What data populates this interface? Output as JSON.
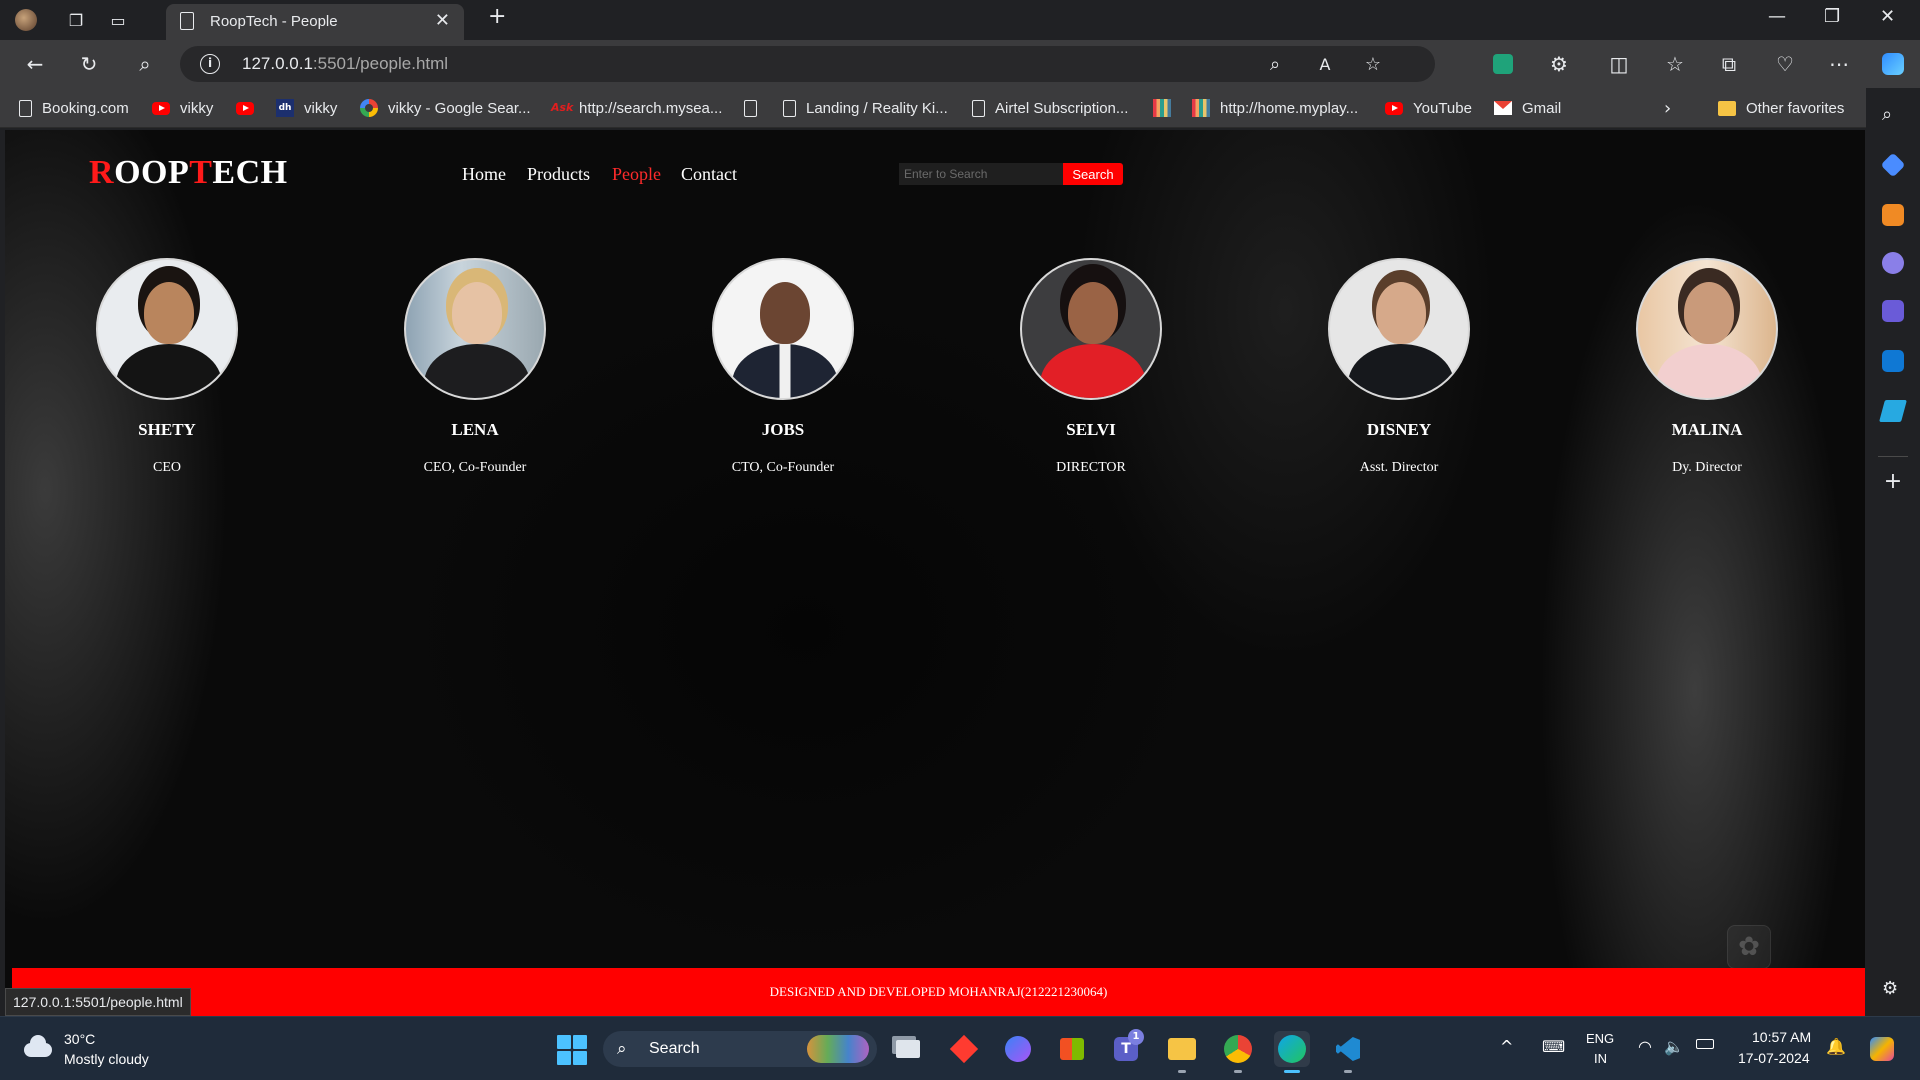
{
  "browser": {
    "tab_title": "RoopTech - People",
    "url_host": "127.0.0.1",
    "url_rest": ":5501/people.html",
    "bookmarks": [
      {
        "label": "Booking.com",
        "icon": "doc-icon"
      },
      {
        "label": "vikky",
        "icon": "youtube-icon"
      },
      {
        "label": "",
        "icon": "youtube-icon"
      },
      {
        "label": "vikky",
        "icon": "dailyhunt-icon"
      },
      {
        "label": "vikky - Google Sear...",
        "icon": "google-icon"
      },
      {
        "label": "http://search.mysea...",
        "icon": "ask-icon"
      },
      {
        "label": "",
        "icon": "doc-icon"
      },
      {
        "label": "Landing / Reality Ki...",
        "icon": "doc-icon"
      },
      {
        "label": "Airtel Subscription...",
        "icon": "doc-icon"
      },
      {
        "label": "",
        "icon": "colorful-bars-icon"
      },
      {
        "label": "http://home.myplay...",
        "icon": "colorful-bars-icon"
      },
      {
        "label": "YouTube",
        "icon": "youtube-icon"
      },
      {
        "label": "Gmail",
        "icon": "gmail-icon"
      }
    ],
    "other_favorites": "Other favorites",
    "status_url": "127.0.0.1:5501/people.html"
  },
  "site": {
    "logo_first": "R",
    "logo_mid1": "OOP",
    "logo_t": "T",
    "logo_mid2": "ECH",
    "nav": [
      "Home",
      "Products",
      "People",
      "Contact"
    ],
    "active_nav": "People",
    "search_placeholder": "Enter to Search",
    "search_button": "Search",
    "people": [
      {
        "name": "SHETY",
        "role": "CEO"
      },
      {
        "name": "LENA",
        "role": "CEO, Co-Founder"
      },
      {
        "name": "JOBS",
        "role": "CTO, Co-Founder"
      },
      {
        "name": "SELVI",
        "role": "DIRECTOR"
      },
      {
        "name": "DISNEY",
        "role": "Asst. Director"
      },
      {
        "name": "MALINA",
        "role": "Dy. Director"
      }
    ],
    "footer": "DESIGNED AND DEVELOPED MOHANRAJ(212221230064)"
  },
  "taskbar": {
    "temp": "30°C",
    "weather": "Mostly cloudy",
    "search_label": "Search",
    "lang1": "ENG",
    "lang2": "IN",
    "time": "10:57 AM",
    "date": "17-07-2024",
    "teams_badge": "1"
  },
  "colors": {
    "accent_red": "#ff0000",
    "nav_active": "#ff2b2b",
    "page_bg": "#090909"
  }
}
